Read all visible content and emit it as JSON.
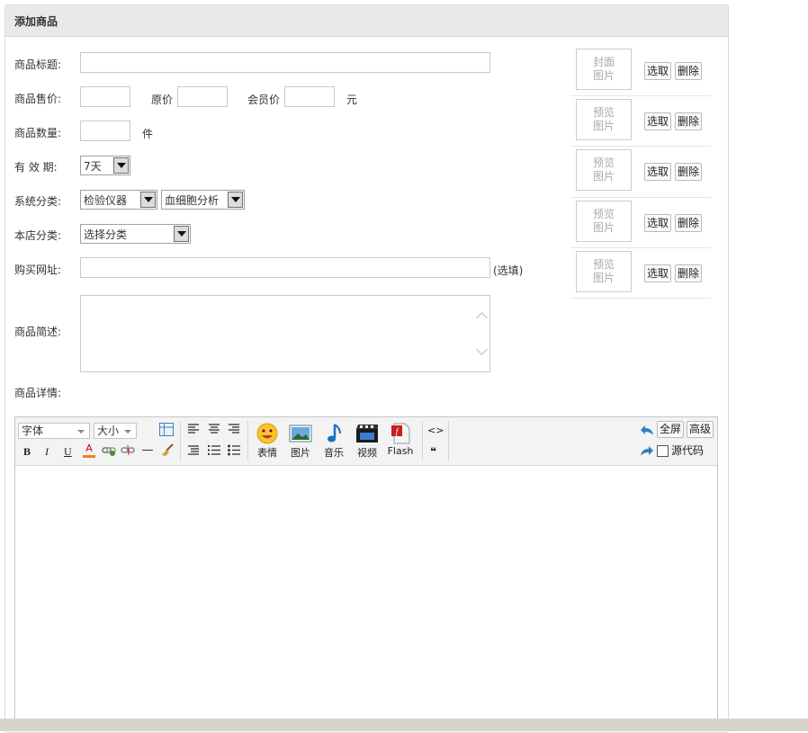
{
  "panel": {
    "title": "添加商品"
  },
  "form": {
    "title_label": "商品标题:",
    "price_label": "商品售价:",
    "orig_price_label": "原价",
    "member_price_label": "会员价",
    "yuan_unit": "元",
    "qty_label": "商品数量:",
    "qty_unit": "件",
    "validity_label": "有 效 期:",
    "validity_value": "7天",
    "sys_cat_label": "系统分类:",
    "sys_cat_1": "检验仪器",
    "sys_cat_2": "血细胞分析",
    "shop_cat_label": "本店分类:",
    "shop_cat_value": "选择分类",
    "buy_url_label": "购买网址:",
    "buy_url_hint": "(选填)",
    "desc_label": "商品简述:",
    "detail_label": "商品详情:"
  },
  "images": [
    {
      "line1": "封面",
      "line2": "图片"
    },
    {
      "line1": "预览",
      "line2": "图片"
    },
    {
      "line1": "预览",
      "line2": "图片"
    },
    {
      "line1": "预览",
      "line2": "图片"
    },
    {
      "line1": "预览",
      "line2": "图片"
    }
  ],
  "image_actions": {
    "pick": "选取",
    "delete": "删除"
  },
  "editor": {
    "font_select": "字体",
    "size_select": "大小",
    "emotion": "表情",
    "image": "图片",
    "music": "音乐",
    "video": "视频",
    "flash": "Flash",
    "fullscreen": "全屏",
    "advanced": "高级",
    "source": "源代码",
    "bold": "B",
    "italic": "I",
    "underline": "U",
    "fontcolor": "A",
    "code": "<>",
    "quote": "❝"
  }
}
